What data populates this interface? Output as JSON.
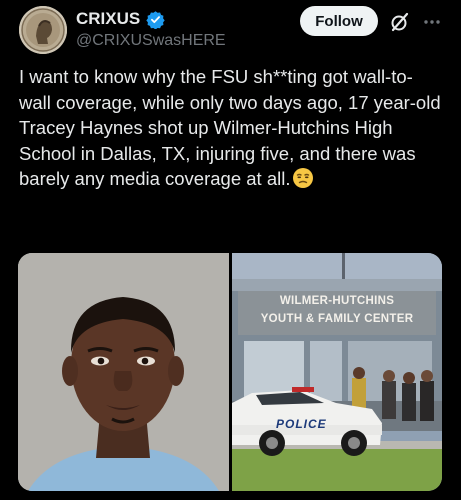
{
  "user": {
    "display_name": "CRIXUS",
    "handle": "@CRIXUSwasHERE",
    "verified": true
  },
  "actions": {
    "follow_label": "Follow"
  },
  "icons": {
    "verified": "verified-badge-icon",
    "grok": "grok-slash-icon",
    "more": "more-horizontal-icon",
    "emoji": "unamused-face-emoji"
  },
  "tweet": {
    "text": "I want to know why the FSU sh**ting got wall-to-wall coverage, while only two days ago, 17 year-old Tracey Haynes shot up Wilmer-Hutchins High School in Dallas, TX, injuring five, and there was barely any media coverage at all."
  },
  "media": {
    "sign_line1": "WILMER-HUTCHINS",
    "sign_line2": "YOUTH & FAMILY CENTER",
    "car_label": "POLICE"
  },
  "colors": {
    "background": "#000000",
    "text": "#e7e9ea",
    "secondary": "#71767b",
    "verified_blue": "#1d9bf0",
    "button_bg": "#eff3f4"
  }
}
